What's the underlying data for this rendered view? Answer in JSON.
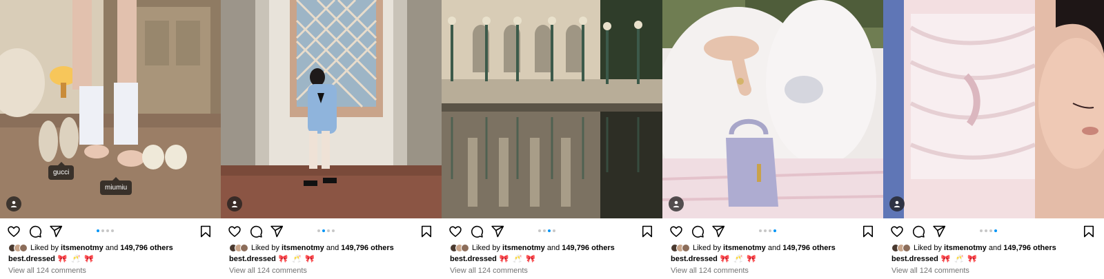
{
  "posts": [
    {
      "tags": [
        "gucci",
        "miumiu"
      ],
      "carousel": {
        "total": 4,
        "active": 1
      },
      "liked_by_prefix": "Liked by",
      "liked_by_user": "itsmenotmy",
      "and_text": "and",
      "others": "149,796 others",
      "caption_user": "best.dressed",
      "caption_emoji": "🎀 🥂 🎀",
      "comments": "View all 124 comments"
    },
    {
      "tags": [],
      "carousel": {
        "total": 4,
        "active": 2
      },
      "liked_by_prefix": "Liked by",
      "liked_by_user": "itsmenotmy",
      "and_text": "and",
      "others": "149,796 others",
      "caption_user": "best.dressed",
      "caption_emoji": "🎀 🥂 🎀",
      "comments": "View all 124 comments"
    },
    {
      "tags": [],
      "carousel": {
        "total": 4,
        "active": 3
      },
      "liked_by_prefix": "Liked by",
      "liked_by_user": "itsmenotmy",
      "and_text": "and",
      "others": "149,796 others",
      "caption_user": "best.dressed",
      "caption_emoji": "🎀 🥂 🎀",
      "comments": "View all 124 comments"
    },
    {
      "tags": [],
      "carousel": {
        "total": 4,
        "active": 4
      },
      "liked_by_prefix": "Liked by",
      "liked_by_user": "itsmenotmy",
      "and_text": "and",
      "others": "149,796 others",
      "caption_user": "best.dressed",
      "caption_emoji": "🎀 🥂 🎀",
      "comments": "View all 124 comments"
    },
    {
      "tags": [],
      "carousel": {
        "total": 4,
        "active": 4
      },
      "liked_by_prefix": "Liked by",
      "liked_by_user": "itsmenotmy",
      "and_text": "and",
      "others": "149,796 others",
      "caption_user": "best.dressed",
      "caption_emoji": "🎀 🥂 🎀",
      "comments": "View all 124 comments"
    }
  ],
  "icons": {
    "like": "heart-icon",
    "comment": "comment-icon",
    "share": "send-icon",
    "save": "bookmark-icon",
    "user": "user-icon"
  },
  "colors": {
    "carousel_active": "#0095f6",
    "carousel_inactive": "#c7c7c7",
    "secondary_text": "#737373"
  }
}
